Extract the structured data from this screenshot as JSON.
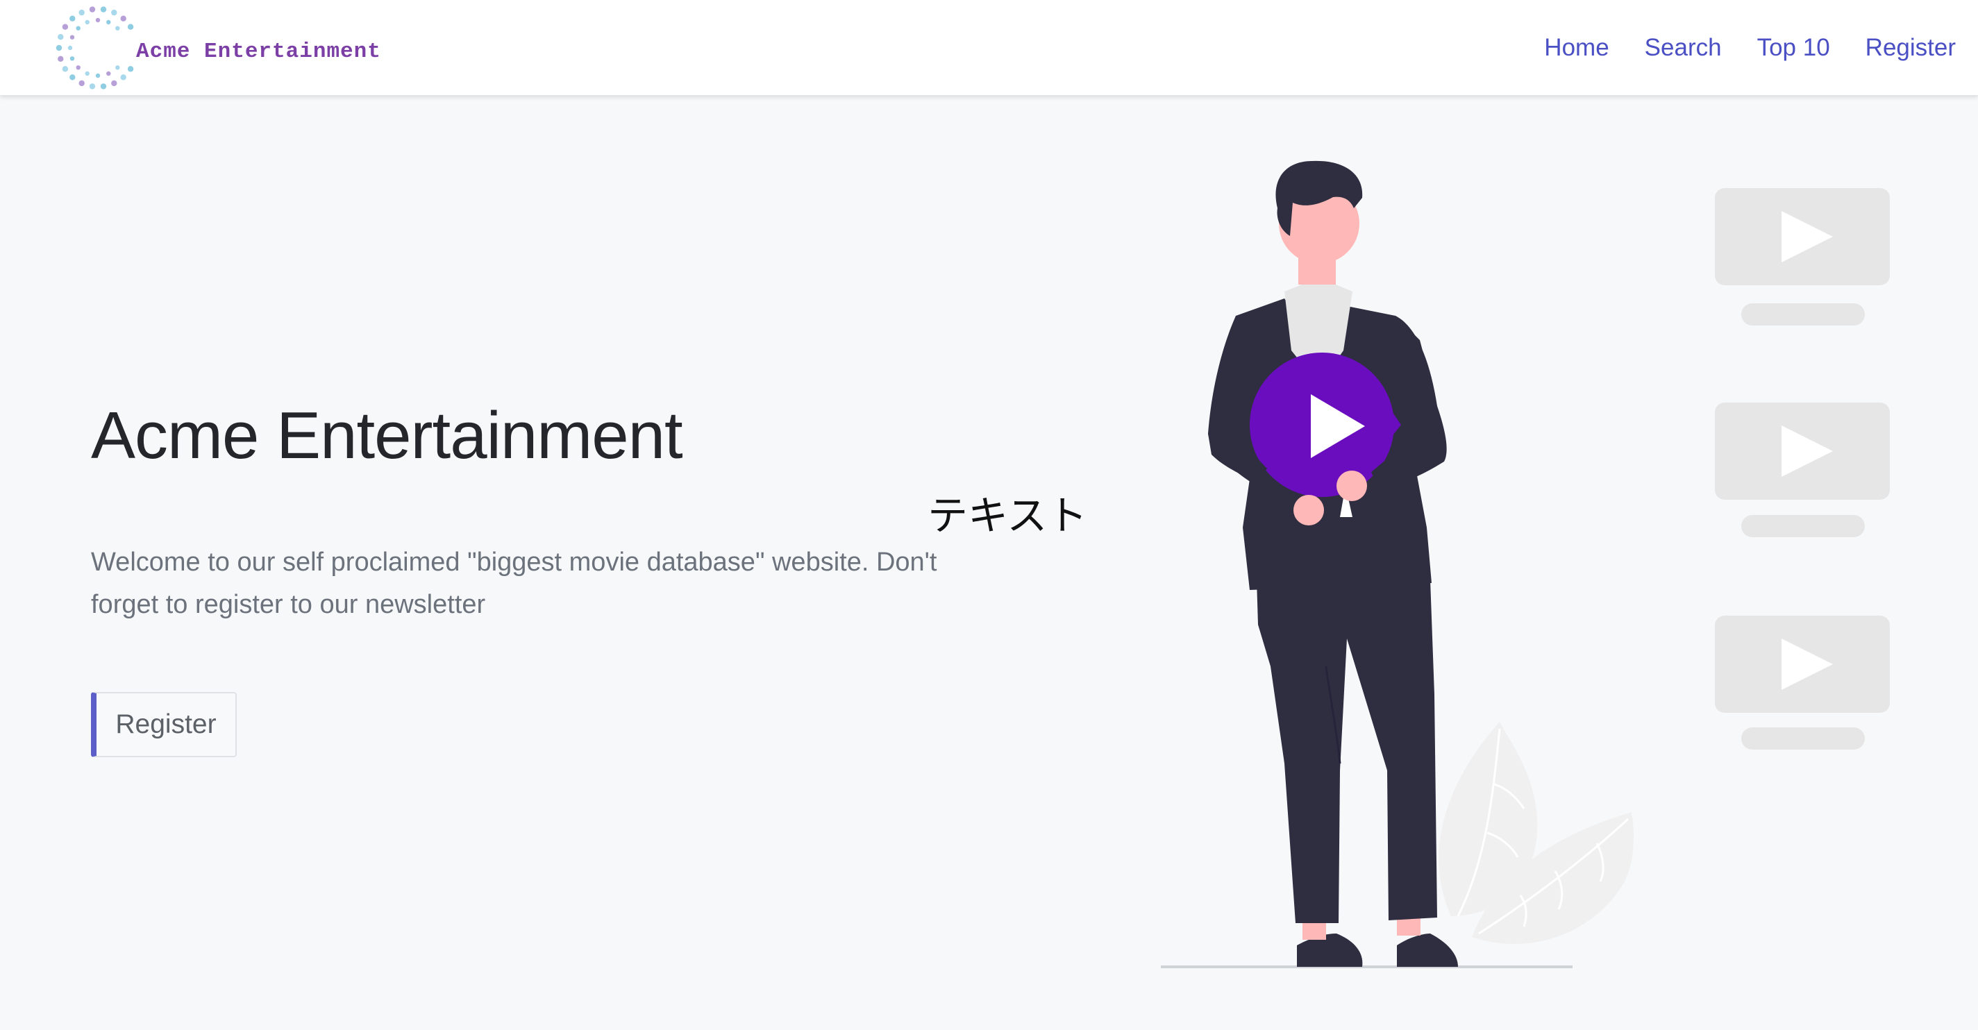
{
  "brand": {
    "name": "Acme Entertainment",
    "logo_icon": "dotted-ring-logo-icon",
    "text_color": "#7b3fa6",
    "dot_colors": [
      "#a8d8ec",
      "#b79fd8",
      "#8fcde3"
    ]
  },
  "nav": {
    "items": [
      {
        "label": "Home"
      },
      {
        "label": "Search"
      },
      {
        "label": "Top 10"
      },
      {
        "label": "Register"
      }
    ],
    "link_color": "#4a4fc4"
  },
  "hero": {
    "title": "Acme Entertainment",
    "lead": "Welcome to our self proclaimed \"biggest movie database\" website. Don't forget to register to our newsletter",
    "cta_label": "Register",
    "cta_accent": "#5b5fc7"
  },
  "stray_text": "テキスト",
  "illustration": {
    "subject": "man-holding-play-button-illustration",
    "play_color": "#6a0dbf",
    "suit_color": "#2f2e41",
    "skin_color": "#ffb8b8",
    "placeholder_color": "#e6e6e6",
    "video_placeholders": [
      {
        "icon": "play-icon"
      },
      {
        "icon": "play-icon"
      },
      {
        "icon": "play-icon"
      }
    ]
  }
}
